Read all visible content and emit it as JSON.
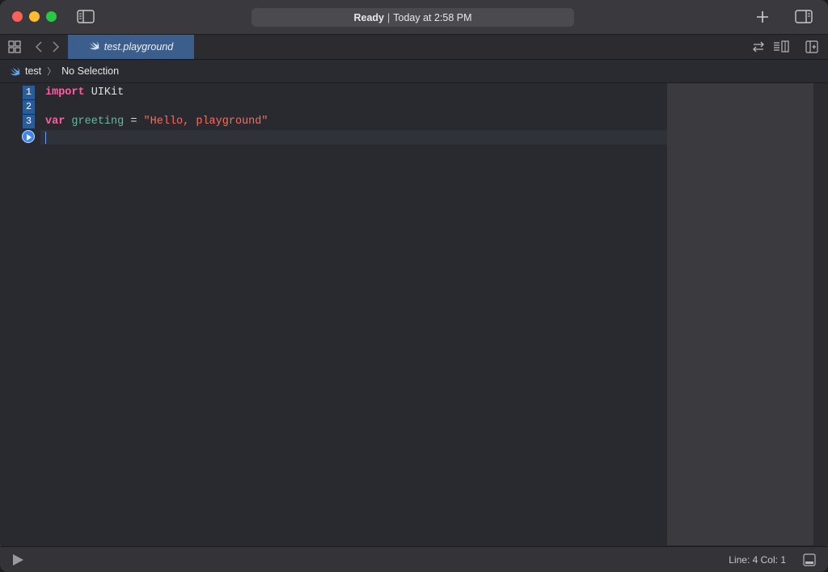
{
  "titlebar": {
    "status_ready": "Ready",
    "status_separator": "|",
    "status_time": "Today at 2:58 PM"
  },
  "tabbar": {
    "active_tab": "test.playground"
  },
  "jumpbar": {
    "project": "test",
    "selection": "No Selection"
  },
  "editor": {
    "line_numbers": [
      "1",
      "2",
      "3"
    ],
    "line1": {
      "keyword": "import",
      "rest": " UIKit"
    },
    "line3": {
      "keyword": "var",
      "name": "greeting",
      "op": " = ",
      "string": "\"Hello, playground\""
    }
  },
  "statusbar": {
    "position": "Line: 4  Col: 1"
  },
  "colors": {
    "accent": "#3b5e8c",
    "keyword": "#fc5fa3",
    "string": "#fc6a5d",
    "identifier": "#67b7a4"
  },
  "icons": [
    "sidebar-toggle-icon",
    "plus-icon",
    "inspector-toggle-icon",
    "grid-icon",
    "back-chevron-icon",
    "forward-chevron-icon",
    "swift-icon",
    "swap-icon",
    "editor-options-icon",
    "add-editor-icon",
    "play-icon",
    "debug-area-icon",
    "run-marker-icon"
  ]
}
